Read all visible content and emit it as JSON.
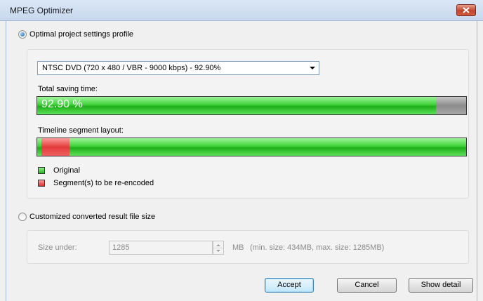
{
  "window": {
    "title": "MPEG Optimizer"
  },
  "options": {
    "optimal_label": "Optimal project settings profile",
    "optimal_selected": true,
    "custom_label": "Customized converted result file size",
    "custom_selected": false
  },
  "profile": {
    "selected": "NTSC DVD (720 x 480 / VBR - 9000 kbps) - 92.90%"
  },
  "saving": {
    "label": "Total saving time:",
    "percent_text": "92.90 %",
    "percent": 92.9
  },
  "timeline": {
    "label": "Timeline segment layout:",
    "reencode_segment_start_fraction": 0.01,
    "reencode_segment_end_fraction": 0.075
  },
  "legend": {
    "original": "Original",
    "reencode": "Segment(s) to be re-encoded"
  },
  "size": {
    "label": "Size under:",
    "value": "1285",
    "unit": "MB",
    "hint": "(min. size: 434MB, max. size: 1285MB)"
  },
  "buttons": {
    "accept": "Accept",
    "cancel": "Cancel",
    "detail": "Show detail"
  },
  "colors": {
    "green": "#35c931",
    "red": "#e33b3b",
    "gray": "#9a9a9a"
  }
}
